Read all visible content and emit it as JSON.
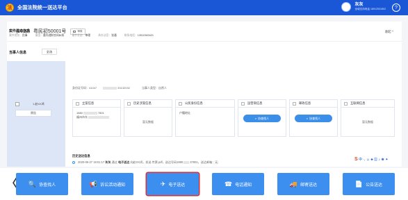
{
  "header": {
    "logo_text": "法",
    "title": "全国法院统一送达平台",
    "user_name": "灰灰",
    "user_phone": "全域支持电话 18912531802",
    "help_label": "?"
  },
  "case": {
    "number": "(2020）粤民初50001号",
    "tag_label": "审核",
    "collapse_label": "收起 ^",
    "basic_title": "案件基本信息",
    "basic_info": [
      {
        "label": "案件类别：",
        "value": "民事"
      },
      {
        "label": "案由：",
        "value": "委托理财合同纠纷"
      },
      {
        "label": "案件状态：",
        "value": "审理"
      },
      {
        "label": "承办法官：",
        "value": "张通"
      },
      {
        "label": "联系电话：",
        "value": "13512383421"
      }
    ]
  },
  "parties": {
    "title": "当事人信息",
    "all_label": "全选",
    "selected_name": "1.赵XX鸿",
    "selected_role": "原告",
    "meta_id": "身份证号码：41047",
    "meta_id_tail": "33132032",
    "meta_type": "当事人类型：自然人"
  },
  "boxes": [
    {
      "title": "立案信息",
      "line1": "1880",
      "line1b": "7801",
      "line2": "福州市东",
      "body": ""
    },
    {
      "title": "历史涉案信息",
      "body": "暂无数据"
    },
    {
      "title": "公民身份信息",
      "line1": "户籍地址",
      "body": ""
    },
    {
      "title": "运营商信息",
      "button": "协查找人"
    },
    {
      "title": "邮政信息",
      "button": "协查找人"
    },
    {
      "title": "互联网信息",
      "body": "暂无数据"
    }
  ],
  "history": {
    "title": "历史送达信息",
    "time": "2020-06-27 19:01:17",
    "user": "灰灰",
    "via": "通过",
    "method": "电子送达",
    "text1": "向赵XX鸿，发送 传票.pdf，送达号码1880",
    "text2": "37801，送达邮箱：无;"
  },
  "ime": {
    "text": "中 ·, ☺ ♣ ▦ ♪ ♚ ✦"
  },
  "actions": [
    {
      "label": "协查找人",
      "icon": "🔍"
    },
    {
      "label": "诉讼活动通知",
      "icon": "📢"
    },
    {
      "label": "电子送达",
      "icon": "✈"
    },
    {
      "label": "电话通知",
      "icon": "☎"
    },
    {
      "label": "邮寄送达",
      "icon": "🚚"
    },
    {
      "label": "公告送达",
      "icon": "📄"
    }
  ],
  "nav": {
    "back": "〈"
  }
}
